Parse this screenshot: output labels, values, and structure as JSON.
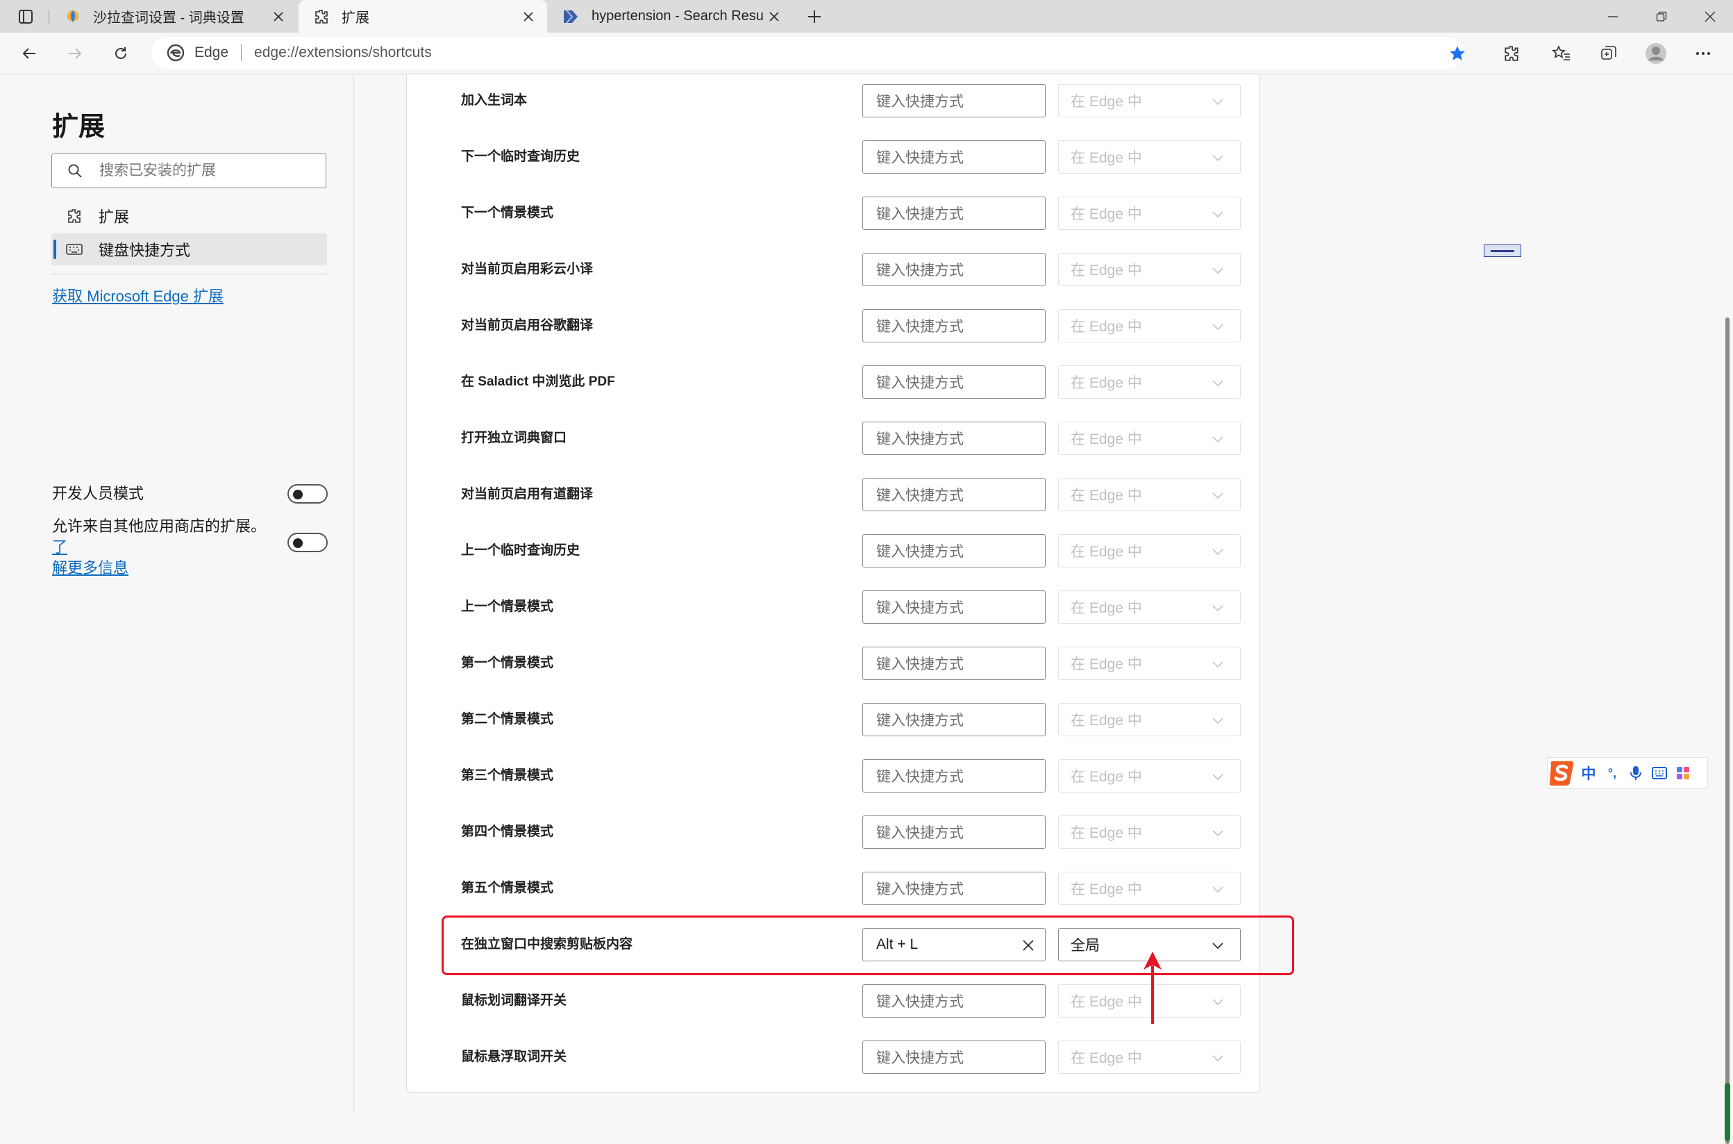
{
  "browser": {
    "tabs": [
      {
        "title": "沙拉查词设置 - 词典设置"
      },
      {
        "title": "扩展"
      },
      {
        "title": "hypertension - Search Results - P"
      }
    ],
    "address": {
      "site": "Edge",
      "url": "edge://extensions/shortcuts"
    }
  },
  "sidebar": {
    "title": "扩展",
    "search_placeholder": "搜索已安装的扩展",
    "items": [
      {
        "label": "扩展"
      },
      {
        "label": "键盘快捷方式"
      }
    ],
    "store_link": "获取 Microsoft Edge 扩展",
    "dev_mode_label": "开发人员模式",
    "other_stores_text": "允许来自其他应用商店的扩展。",
    "other_stores_link_1": "了",
    "other_stores_link_2": "解更多信息"
  },
  "shortcuts": [
    {
      "label": "加入生词本",
      "shortcut": "键入快捷方式",
      "scope": "在 Edge 中"
    },
    {
      "label": "下一个临时查询历史",
      "shortcut": "键入快捷方式",
      "scope": "在 Edge 中"
    },
    {
      "label": "下一个情景模式",
      "shortcut": "键入快捷方式",
      "scope": "在 Edge 中"
    },
    {
      "label": "对当前页启用彩云小译",
      "shortcut": "键入快捷方式",
      "scope": "在 Edge 中"
    },
    {
      "label": "对当前页启用谷歌翻译",
      "shortcut": "键入快捷方式",
      "scope": "在 Edge 中"
    },
    {
      "label": "在 Saladict 中浏览此 PDF",
      "shortcut": "键入快捷方式",
      "scope": "在 Edge 中"
    },
    {
      "label": "打开独立词典窗口",
      "shortcut": "键入快捷方式",
      "scope": "在 Edge 中"
    },
    {
      "label": "对当前页启用有道翻译",
      "shortcut": "键入快捷方式",
      "scope": "在 Edge 中"
    },
    {
      "label": "上一个临时查询历史",
      "shortcut": "键入快捷方式",
      "scope": "在 Edge 中"
    },
    {
      "label": "上一个情景模式",
      "shortcut": "键入快捷方式",
      "scope": "在 Edge 中"
    },
    {
      "label": "第一个情景模式",
      "shortcut": "键入快捷方式",
      "scope": "在 Edge 中"
    },
    {
      "label": "第二个情景模式",
      "shortcut": "键入快捷方式",
      "scope": "在 Edge 中"
    },
    {
      "label": "第三个情景模式",
      "shortcut": "键入快捷方式",
      "scope": "在 Edge 中"
    },
    {
      "label": "第四个情景模式",
      "shortcut": "键入快捷方式",
      "scope": "在 Edge 中"
    },
    {
      "label": "第五个情景模式",
      "shortcut": "键入快捷方式",
      "scope": "在 Edge 中"
    },
    {
      "label": "在独立窗口中搜索剪贴板内容",
      "shortcut": "Alt + L",
      "scope": "全局"
    },
    {
      "label": "鼠标划词翻译开关",
      "shortcut": "键入快捷方式",
      "scope": "在 Edge 中"
    },
    {
      "label": "鼠标悬浮取词开关",
      "shortcut": "键入快捷方式",
      "scope": "在 Edge 中"
    }
  ],
  "ime": {
    "mode": "中",
    "punct": "°,"
  },
  "colors": {
    "accent": "#0f6cbd",
    "highlight": "#e81224",
    "favorite_star": "#1a73e8"
  }
}
